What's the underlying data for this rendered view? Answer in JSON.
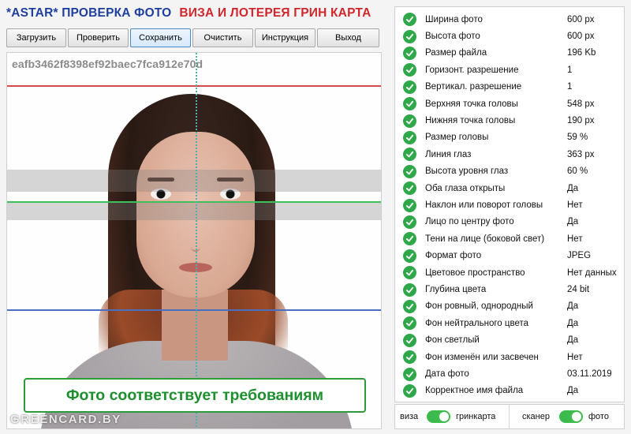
{
  "header": {
    "brand": "*ASTAR* ПРОВЕРКА ФОТО",
    "subtitle": "ВИЗА И ЛОТЕРЕЯ ГРИН КАРТА"
  },
  "toolbar": {
    "buttons": [
      "Загрузить",
      "Проверить",
      "Сохранить",
      "Очистить",
      "Инструкция",
      "Выход"
    ],
    "active": "Сохранить"
  },
  "photo": {
    "hash": "eafb3462f8398ef92baec7fca912e70d",
    "result_message": "Фото соответствует требованиям",
    "watermark": "GREENCARD.BY"
  },
  "checks": [
    {
      "label": "Ширина фото",
      "value": "600 px"
    },
    {
      "label": "Высота фото",
      "value": "600 px"
    },
    {
      "label": "Размер файла",
      "value": "196 Kb"
    },
    {
      "label": "Горизонт. разрешение",
      "value": "1"
    },
    {
      "label": "Вертикал. разрешение",
      "value": "1"
    },
    {
      "label": "Верхняя точка головы",
      "value": "548 px"
    },
    {
      "label": "Нижняя точка головы",
      "value": "190 px"
    },
    {
      "label": "Размер головы",
      "value": "59 %"
    },
    {
      "label": "Линия глаз",
      "value": "363 px"
    },
    {
      "label": "Высота уровня глаз",
      "value": "60 %"
    },
    {
      "label": "Оба глаза открыты",
      "value": "Да"
    },
    {
      "label": "Наклон или поворот головы",
      "value": "Нет"
    },
    {
      "label": "Лицо по центру фото",
      "value": "Да"
    },
    {
      "label": "Тени на лице (боковой свет)",
      "value": "Нет"
    },
    {
      "label": "Формат фото",
      "value": "JPEG"
    },
    {
      "label": "Цветовое пространство",
      "value": "Нет данных"
    },
    {
      "label": "Глубина цвета",
      "value": "24 bit"
    },
    {
      "label": "Фон ровный, однородный",
      "value": "Да"
    },
    {
      "label": "Фон нейтрального цвета",
      "value": "Да"
    },
    {
      "label": "Фон светлый",
      "value": "Да"
    },
    {
      "label": "Фон изменён или засвечен",
      "value": "Нет"
    },
    {
      "label": "Дата фото",
      "value": "03.11.2019"
    },
    {
      "label": "Корректное имя файла",
      "value": "Да"
    }
  ],
  "toggles": {
    "left": {
      "off_label": "виза",
      "on_label": "гринкарта",
      "on": true
    },
    "right": {
      "off_label": "сканер",
      "on_label": "фото",
      "on": true
    }
  },
  "colors": {
    "brand_blue": "#1f3f9e",
    "brand_red": "#d0262c",
    "ok_green": "#2fa84a",
    "result_green": "#1e8f2e",
    "top_line": "#d84a4a",
    "eye_line": "#3fbf5a",
    "chin_line": "#4b6fbf",
    "center_line": "#4fb0ae"
  }
}
